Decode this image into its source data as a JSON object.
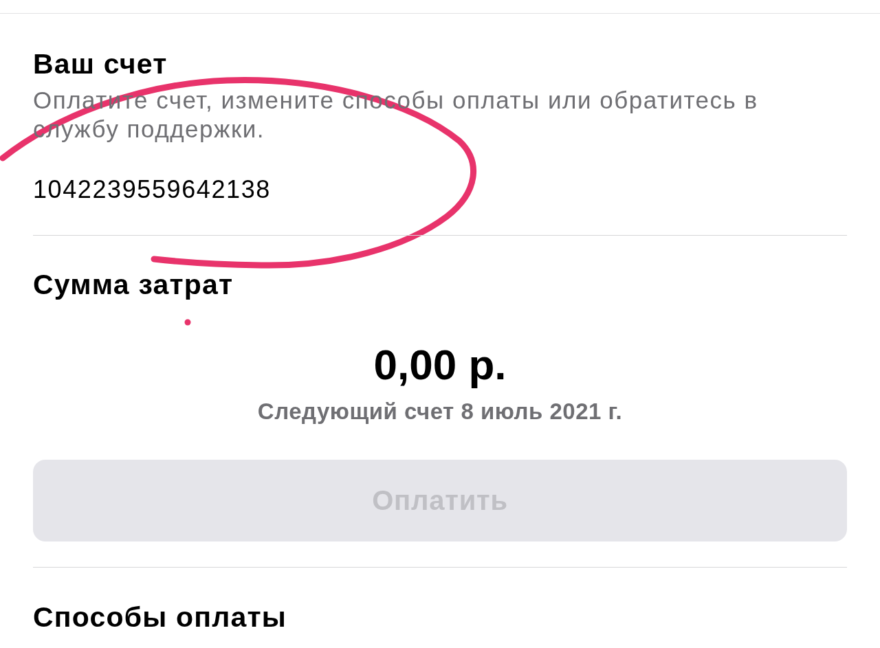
{
  "account": {
    "title": "Ваш счет",
    "description": "Оплатите счет, измените способы оплаты или обратитесь в службу поддержки.",
    "number": "1042239559642138"
  },
  "spending": {
    "title": "Сумма затрат",
    "amount": "0,00 р.",
    "next_bill": "Следующий счет 8 июль 2021 г.",
    "pay_button": {
      "label": "Оплатить",
      "disabled": true
    }
  },
  "payment_methods": {
    "title": "Способы оплаты"
  }
}
